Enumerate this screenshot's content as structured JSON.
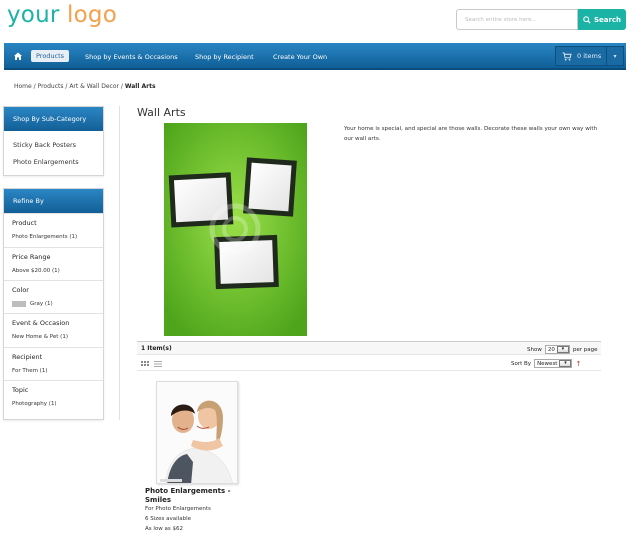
{
  "brand": {
    "logo_part1": "your ",
    "logo_part2": "logo",
    "color1": "#1bb3a6",
    "color2": "#f2a14d"
  },
  "search": {
    "placeholder": "Search entire store here...",
    "button_label": "Search"
  },
  "nav": {
    "items": [
      "Products",
      "Shop by Events & Occasions",
      "Shop by Recipient",
      "Create Your Own"
    ],
    "active": "Products"
  },
  "cart": {
    "label": "0 items"
  },
  "breadcrumb": {
    "parts": [
      "Home",
      "Products",
      "Art & Wall Decor"
    ],
    "current": "Wall Arts",
    "separator": " / "
  },
  "sidebar": {
    "subcat_title": "Shop By Sub-Category",
    "subcats": [
      "Sticky Back Posters",
      "Photo Enlargements"
    ],
    "refine_title": "Refine By",
    "filters": [
      {
        "title": "Product",
        "value": "Photo Enlargements (1)"
      },
      {
        "title": "Price Range",
        "value": "Above $20.00 (1)"
      },
      {
        "title": "Color",
        "value": "Gray (1)",
        "swatch": "#bdbdbd"
      },
      {
        "title": "Event & Occasion",
        "value": "New Home & Pet (1)"
      },
      {
        "title": "Recipient",
        "value": "For Them (1)"
      },
      {
        "title": "Topic",
        "value": "Photography (1)"
      }
    ]
  },
  "main": {
    "title": "Wall Arts",
    "description": "Your home is special, and special are those walls. Decorate these walls your own way with our wall arts.",
    "item_count": "1 Item(s)",
    "show_label": "Show",
    "show_value": "20",
    "per_page": "per page",
    "sort_label": "Sort By",
    "sort_value": "Newest"
  },
  "product": {
    "name": "Photo Enlargements - Smiles",
    "category": "For Photo Enlargements",
    "sizes": "6 Sizes available",
    "price": "As low as $62"
  }
}
